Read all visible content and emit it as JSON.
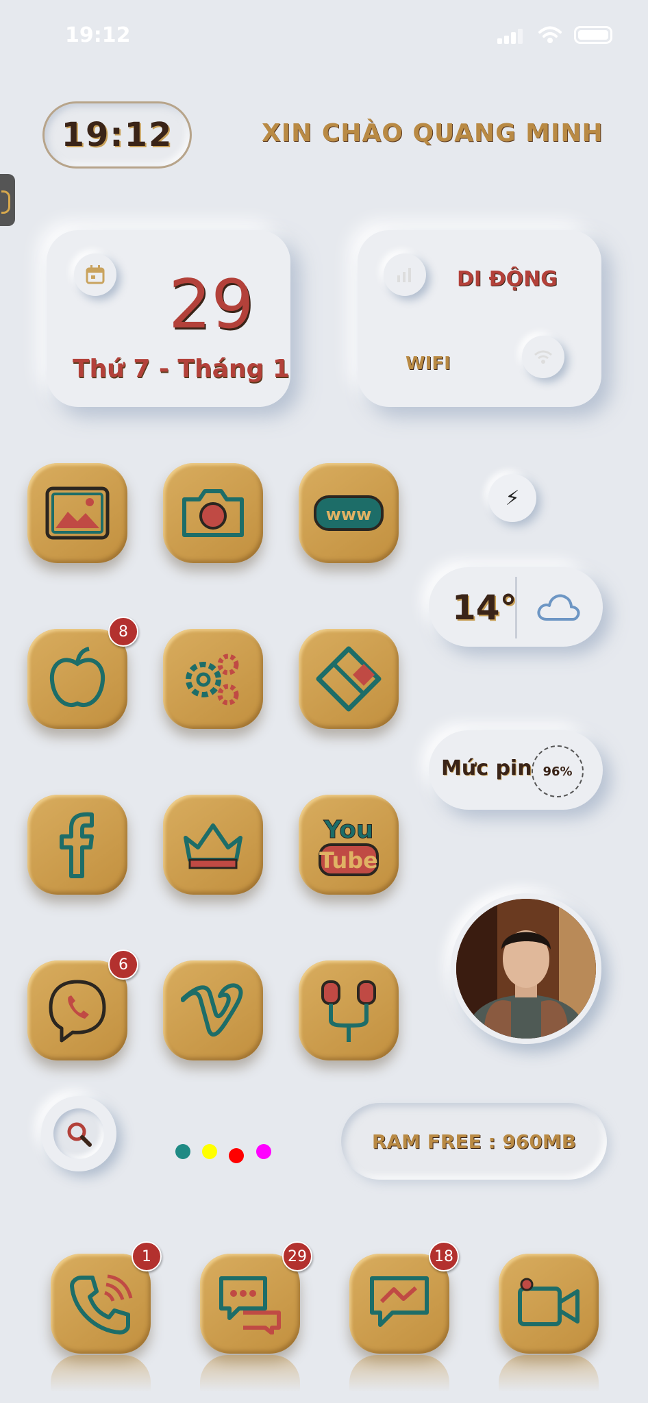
{
  "status_bar": {
    "time": "19:12"
  },
  "clock_widget": {
    "time": "19:12"
  },
  "greeting": "XIN CHÀO QUANG MINH",
  "date_widget": {
    "day": "29",
    "label": "Thứ 7 - Tháng 1"
  },
  "network_widget": {
    "mobile_label": "DI ĐỘNG",
    "wifi_label": "WIFI"
  },
  "apps": [
    {
      "id": "photos",
      "icon": "photo-icon"
    },
    {
      "id": "camera",
      "icon": "camera-icon"
    },
    {
      "id": "browser",
      "icon": "www-icon"
    },
    {
      "id": "app-store",
      "icon": "apple-icon",
      "badge": "8"
    },
    {
      "id": "settings",
      "icon": "gears-icon"
    },
    {
      "id": "kinemaster",
      "icon": "kinemaster-icon"
    },
    {
      "id": "facebook",
      "icon": "facebook-icon"
    },
    {
      "id": "crown-app",
      "icon": "crown-icon"
    },
    {
      "id": "youtube",
      "icon": "youtube-icon",
      "text_top": "You",
      "text_bottom": "Tube"
    },
    {
      "id": "viber",
      "icon": "viber-icon",
      "badge": "6"
    },
    {
      "id": "vimeo",
      "icon": "vimeo-icon"
    },
    {
      "id": "earphones",
      "icon": "earphones-icon"
    }
  ],
  "weather_widget": {
    "temperature": "14°",
    "icon": "cloud-icon"
  },
  "battery_widget": {
    "label": "Mức pin",
    "percent": "96%"
  },
  "color_dots": [
    "#1f8a84",
    "#ffff00",
    "#ff0000",
    "#ff00ff"
  ],
  "ram_widget": {
    "label": "RAM FREE : 960MB"
  },
  "dock": [
    {
      "id": "phone",
      "icon": "phone-icon",
      "badge": "1"
    },
    {
      "id": "messages",
      "icon": "chat-bubbles-icon",
      "badge": "29"
    },
    {
      "id": "messenger",
      "icon": "messenger-icon",
      "badge": "18"
    },
    {
      "id": "facetime",
      "icon": "video-camera-icon"
    }
  ]
}
